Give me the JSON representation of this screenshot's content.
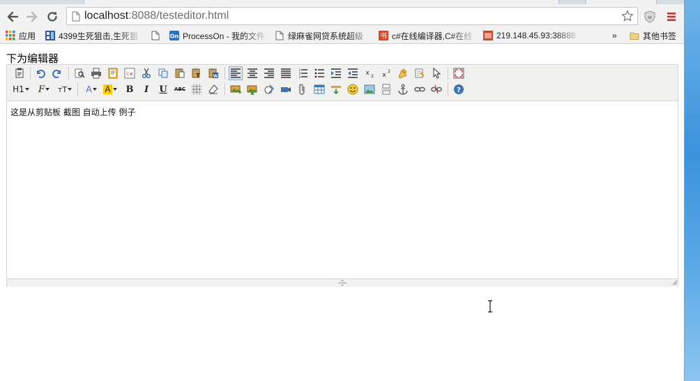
{
  "browser": {
    "url_host": "localhost",
    "url_rest": ":8088/testeditor.html"
  },
  "bookmarks": [
    {
      "label": "应用",
      "icon": "apps-grid-icon"
    },
    {
      "label": "4399生死狙击,生死狙",
      "icon": "site-favicon"
    },
    {
      "label": "",
      "icon": "page-icon"
    },
    {
      "label": "ProcessOn - 我的文件",
      "icon": "processon-icon"
    },
    {
      "label": "绿麻雀网贷系统超级",
      "icon": "page-icon"
    },
    {
      "label": "c#在线编译器,C#在线",
      "icon": "book-icon"
    },
    {
      "label": "219.148.45.93:38888",
      "icon": "site-favicon"
    },
    {
      "label": "其他书签",
      "icon": "folder-icon"
    }
  ],
  "overflow_chevron": "»",
  "page": {
    "heading": "下为编辑器",
    "editor_content": "这是从剪贴板 截图 自动上传 例子"
  },
  "editor_toolbar": {
    "heading_label": "H1",
    "font_family_label": "F",
    "font_size_label": "тT",
    "font_color_label": "A",
    "highlight_label": "A",
    "bold_label": "B",
    "italic_label": "I",
    "underline_label": "U",
    "strike_label": "ABC"
  },
  "colors": {
    "accent_blue": "#3d74b8",
    "highlight_yellow": "#ffcc00",
    "desktop_blue": "#3d8fd6"
  }
}
